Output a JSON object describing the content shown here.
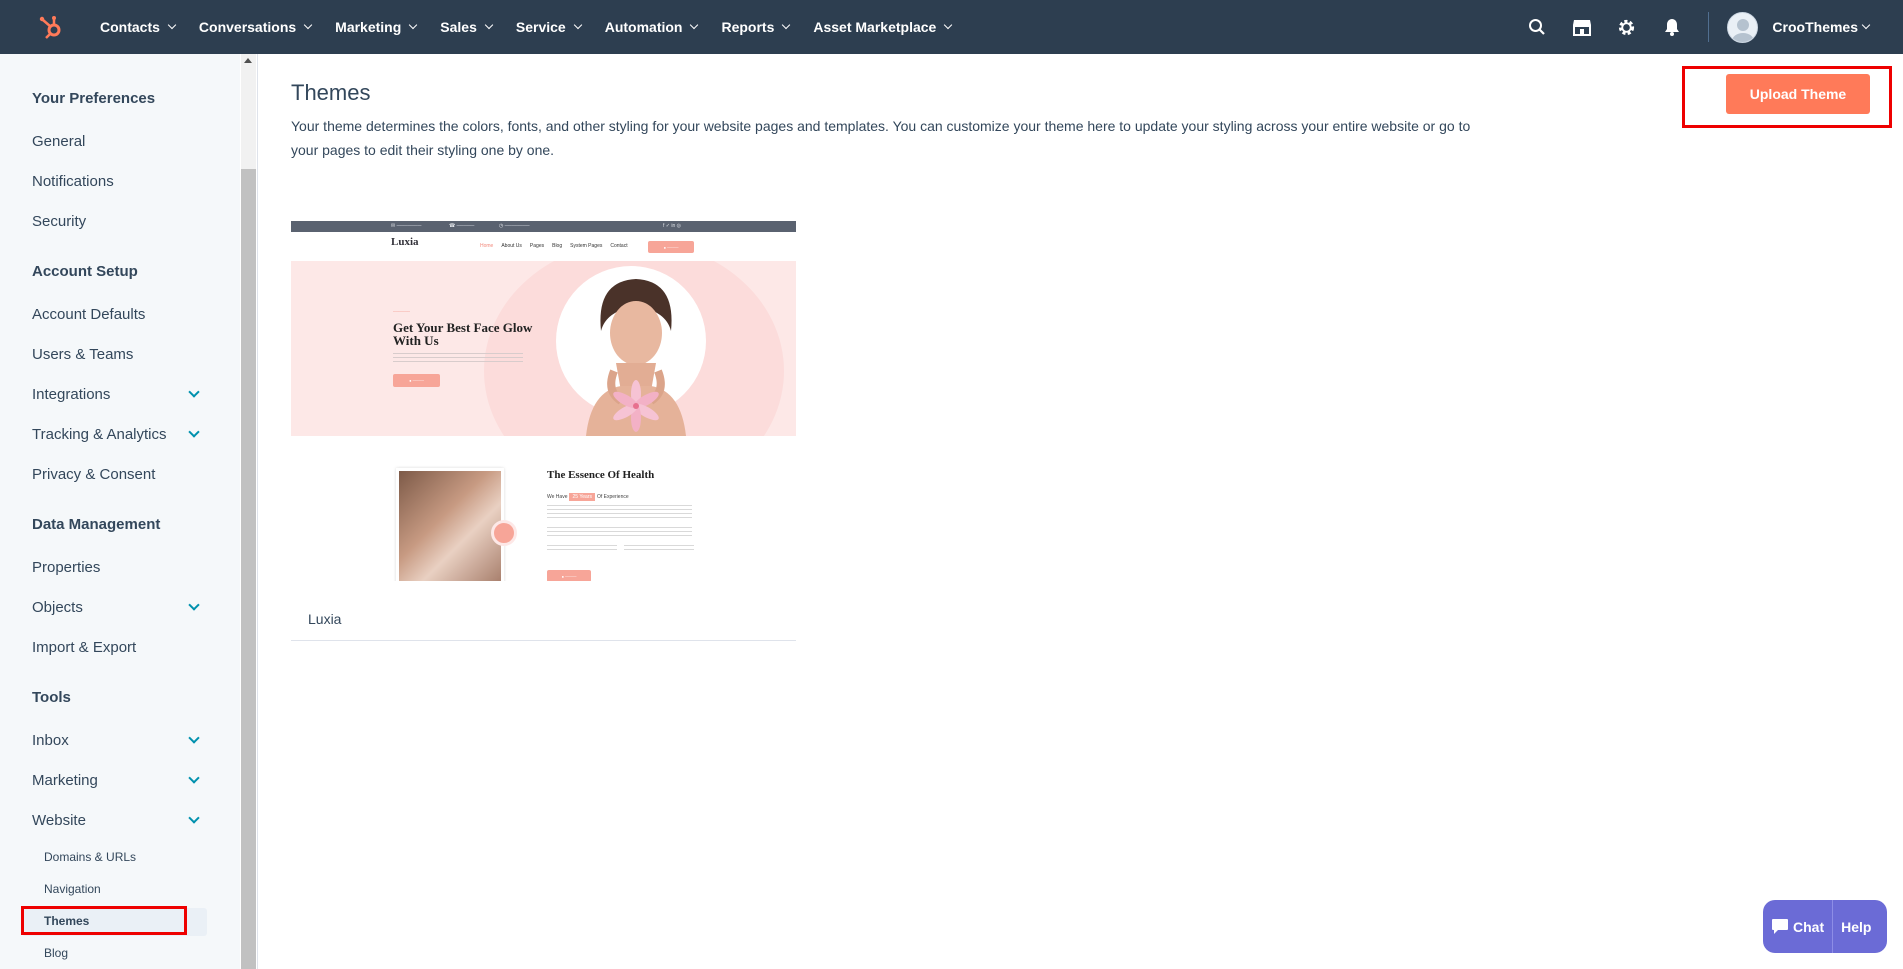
{
  "nav": {
    "items": [
      "Contacts",
      "Conversations",
      "Marketing",
      "Sales",
      "Service",
      "Automation",
      "Reports",
      "Asset Marketplace"
    ],
    "account_name": "CrooThemes"
  },
  "sidebar": {
    "preferences_heading": "Your Preferences",
    "general": "General",
    "notifications": "Notifications",
    "security": "Security",
    "account_setup_heading": "Account Setup",
    "account_defaults": "Account Defaults",
    "users_teams": "Users & Teams",
    "integrations": "Integrations",
    "tracking": "Tracking & Analytics",
    "privacy": "Privacy & Consent",
    "data_heading": "Data Management",
    "properties": "Properties",
    "objects": "Objects",
    "import_export": "Import & Export",
    "tools_heading": "Tools",
    "inbox": "Inbox",
    "marketing": "Marketing",
    "website": "Website",
    "domains": "Domains & URLs",
    "navigation": "Navigation",
    "themes": "Themes",
    "blog": "Blog"
  },
  "main": {
    "title": "Themes",
    "description": "Your theme determines the colors, fonts, and other styling for your website pages and templates. You can customize your theme here to update your styling across your entire website or go to your pages to edit their styling one by one.",
    "upload_button": "Upload Theme"
  },
  "theme_card": {
    "name": "Luxia",
    "preview": {
      "logo": "Luxia",
      "nav_links": [
        "Home",
        "About Us",
        "Pages",
        "Blog",
        "System Pages",
        "Contact"
      ],
      "hero_title": "Get Your Best Face Glow With Us",
      "about_title": "The Essence Of Health",
      "about_line_pre": "We Have",
      "about_line_badge": "25 Years",
      "about_line_post": "Of Experience"
    }
  },
  "chat": {
    "chat_label": "Chat",
    "help_label": "Help"
  },
  "colors": {
    "nav_bg": "#2d3e50",
    "accent": "#ff7a59",
    "link": "#0091ae",
    "highlight": "#ee0000",
    "chat": "#6b6bd6"
  }
}
